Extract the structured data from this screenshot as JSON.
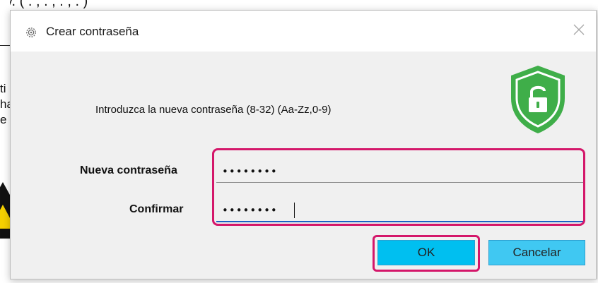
{
  "background": {
    "top_text": "y.  (   .   ,   .   ,   .   ,   .   )",
    "left_fragments": [
      "ti",
      "ha",
      "e"
    ]
  },
  "dialog": {
    "title": "Crear contraseña",
    "app_icon": "gear-icon",
    "close_icon": "close-icon",
    "instruction": "Introduzca la nueva contraseña (8-32) (Aa-Zz,0-9)",
    "shield_icon": "shield-unlock-icon",
    "new_password": {
      "label": "Nueva contraseña",
      "value": "••••••••"
    },
    "confirm_password": {
      "label": "Confirmar",
      "value": "••••••••"
    },
    "ok_label": "OK",
    "cancel_label": "Cancelar",
    "colors": {
      "highlight": "#d4176a",
      "button": "#00bff0",
      "shield": "#3fae49",
      "focus_underline": "#1a62c4"
    }
  }
}
